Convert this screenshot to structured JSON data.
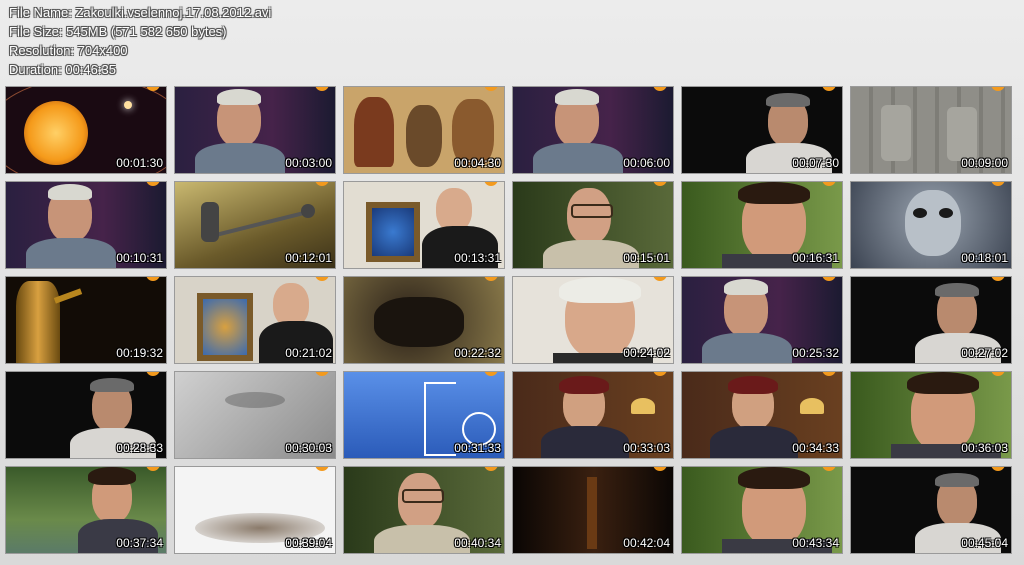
{
  "info": {
    "file_name": "File Name: Zakoulki.vselennoj.17.08.2012.avi",
    "file_size": "File Size: 545MB (571 582 650 bytes)",
    "resolution": "Resolution: 704x400",
    "duration": "Duration: 00:46:35"
  },
  "colors": {
    "badge": "#f39a1e",
    "frame_border": "#9a9a9a"
  },
  "thumbnails": [
    {
      "timestamp": "00:01:30",
      "scene": "sun-orbits",
      "bg": "#1a0a12"
    },
    {
      "timestamp": "00:03:00",
      "scene": "man-interview",
      "bg": "#1c1830"
    },
    {
      "timestamp": "00:04:30",
      "scene": "illustrated-warriors",
      "bg": "#c9a46a"
    },
    {
      "timestamp": "00:06:00",
      "scene": "man-interview",
      "bg": "#1e1a30"
    },
    {
      "timestamp": "00:07:30",
      "scene": "man-dark",
      "bg": "#0b0b0b"
    },
    {
      "timestamp": "00:09:00",
      "scene": "stone-relief",
      "bg": "#8d8c86"
    },
    {
      "timestamp": "00:10:31",
      "scene": "man-interview",
      "bg": "#1e1a30"
    },
    {
      "timestamp": "00:12:01",
      "scene": "sky-object",
      "bg": "#8a7a3a"
    },
    {
      "timestamp": "00:13:31",
      "scene": "man-fireplace",
      "bg": "#d8d2c6"
    },
    {
      "timestamp": "00:15:01",
      "scene": "man-glasses-forest",
      "bg": "#3c4a2a"
    },
    {
      "timestamp": "00:16:31",
      "scene": "man-closeup-forest",
      "bg": "#4a5a2a"
    },
    {
      "timestamp": "00:18:01",
      "scene": "alien-figure",
      "bg": "#5a6270"
    },
    {
      "timestamp": "00:19:32",
      "scene": "gold-statue",
      "bg": "#120c06"
    },
    {
      "timestamp": "00:21:02",
      "scene": "man-lion-painting",
      "bg": "#cfcac0"
    },
    {
      "timestamp": "00:22:32",
      "scene": "dark-creature",
      "bg": "#6a5a3a"
    },
    {
      "timestamp": "00:24:02",
      "scene": "man-closeup-white",
      "bg": "#e6e2da"
    },
    {
      "timestamp": "00:25:32",
      "scene": "man-interview",
      "bg": "#1e1a30"
    },
    {
      "timestamp": "00:27:02",
      "scene": "man-dark",
      "bg": "#0b0b0b"
    },
    {
      "timestamp": "00:28:33",
      "scene": "man-dark",
      "bg": "#0b0b0b"
    },
    {
      "timestamp": "00:30:03",
      "scene": "gray-surface",
      "bg": "#b4b4b4"
    },
    {
      "timestamp": "00:31:33",
      "scene": "blue-graphic",
      "bg": "#3f73d6"
    },
    {
      "timestamp": "00:33:03",
      "scene": "woman-room",
      "bg": "#3a2216"
    },
    {
      "timestamp": "00:34:33",
      "scene": "woman-room",
      "bg": "#3a2216"
    },
    {
      "timestamp": "00:36:03",
      "scene": "man-closeup-forest",
      "bg": "#4a6a2a"
    },
    {
      "timestamp": "00:37:34",
      "scene": "man-river",
      "bg": "#3a5a2a"
    },
    {
      "timestamp": "00:39:04",
      "scene": "white-smoke",
      "bg": "#f2f2f2"
    },
    {
      "timestamp": "00:40:34",
      "scene": "man-glasses-forest",
      "bg": "#3c4a2a"
    },
    {
      "timestamp": "00:42:04",
      "scene": "dark-curtain",
      "bg": "#140a04"
    },
    {
      "timestamp": "00:43:34",
      "scene": "man-closeup-forest",
      "bg": "#5a7a3a"
    },
    {
      "timestamp": "00:45:04",
      "scene": "man-dark",
      "bg": "#0b0b0b"
    }
  ]
}
